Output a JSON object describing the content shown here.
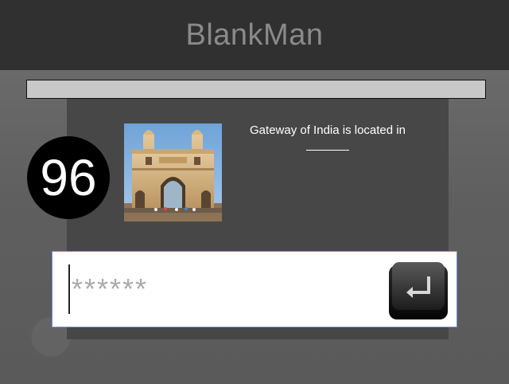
{
  "header": {
    "title": "BlankMan"
  },
  "progress": {
    "fraction": 0.0
  },
  "timer": {
    "value": "96"
  },
  "question": {
    "text": "Gateway of India is located in",
    "image_icon": "gateway-of-india-photo"
  },
  "answer": {
    "value": "",
    "placeholder": "******"
  },
  "submit": {
    "icon": "enter-key-icon"
  },
  "colors": {
    "header_bg": "#303030",
    "title": "#8a8a8a",
    "panel_bg": "#474747",
    "progress_track": "#c8c8c8",
    "timer_bg": "#000000",
    "input_border": "#6d8fd3"
  }
}
